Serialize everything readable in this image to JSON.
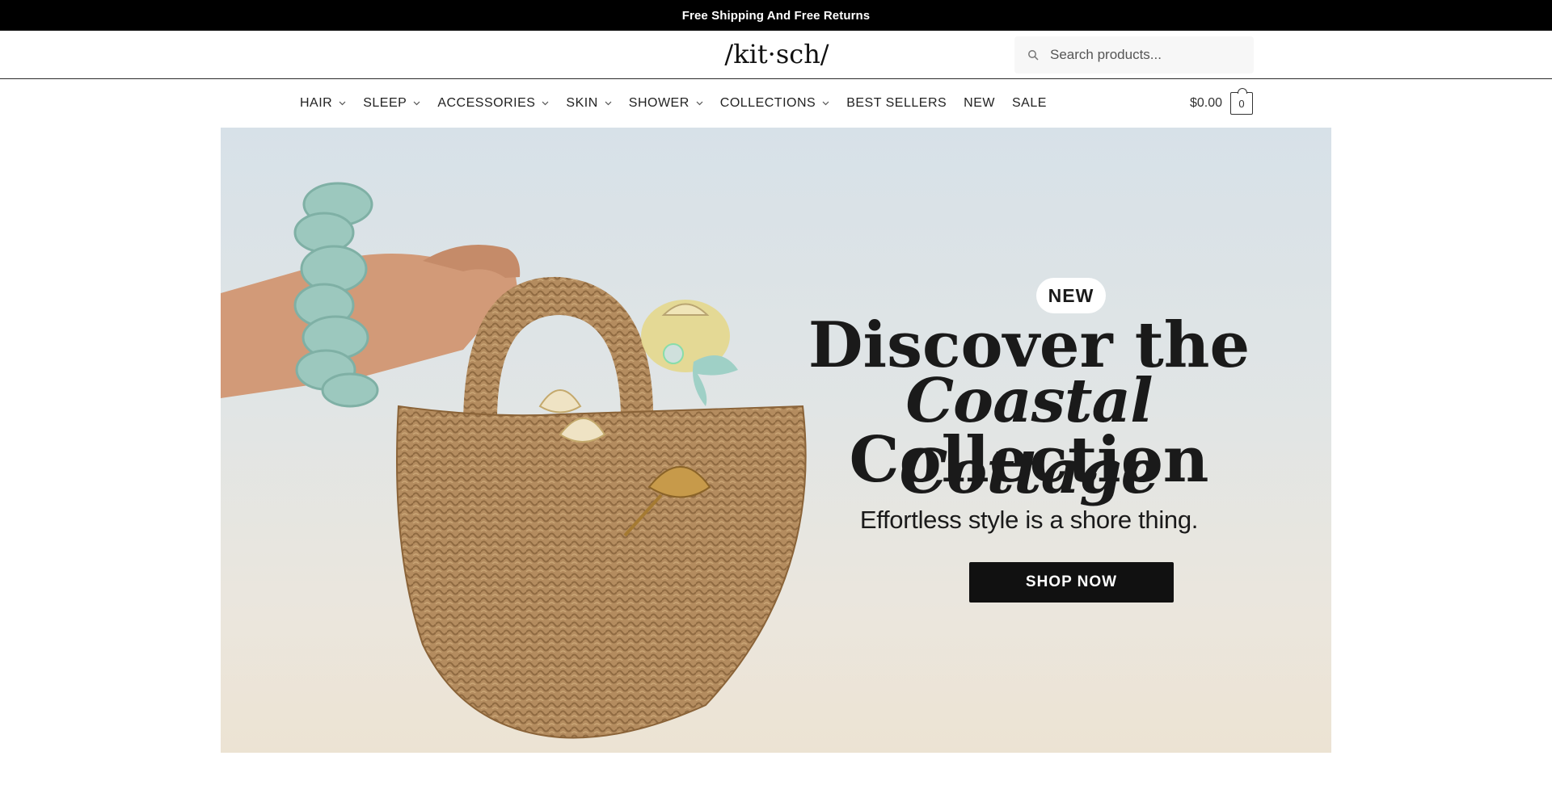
{
  "announcement": {
    "text": "Free Shipping And Free Returns"
  },
  "header": {
    "logo_text": "/kit·sch/",
    "search": {
      "placeholder": "Search products...",
      "icon": "search-icon"
    }
  },
  "nav": {
    "items": [
      {
        "label": "HAIR",
        "has_dropdown": true
      },
      {
        "label": "SLEEP",
        "has_dropdown": true
      },
      {
        "label": "ACCESSORIES",
        "has_dropdown": true
      },
      {
        "label": "SKIN",
        "has_dropdown": true
      },
      {
        "label": "SHOWER",
        "has_dropdown": true
      },
      {
        "label": "COLLECTIONS",
        "has_dropdown": true
      },
      {
        "label": "BEST SELLERS",
        "has_dropdown": false
      },
      {
        "label": "NEW",
        "has_dropdown": false
      },
      {
        "label": "SALE",
        "has_dropdown": false
      }
    ],
    "cart": {
      "total": "$0.00",
      "count": "0",
      "icon": "shopping-bag-icon"
    }
  },
  "hero": {
    "badge": "NEW",
    "headline_line1": "Discover the",
    "headline_line2": "Coastal Cottage",
    "headline_line3": "Collection",
    "subtitle": "Effortless style is a shore thing.",
    "cta_label": "SHOP NOW",
    "image": "hand-holding-woven-basket-with-shell-hair-clips-and-knit-scrunchie"
  },
  "colors": {
    "announcement_bg": "#000000",
    "cta_bg": "#111111",
    "hero_sky": "#d7e1e8",
    "hero_sand": "#ece3d3",
    "basket": "#b48c5f"
  }
}
